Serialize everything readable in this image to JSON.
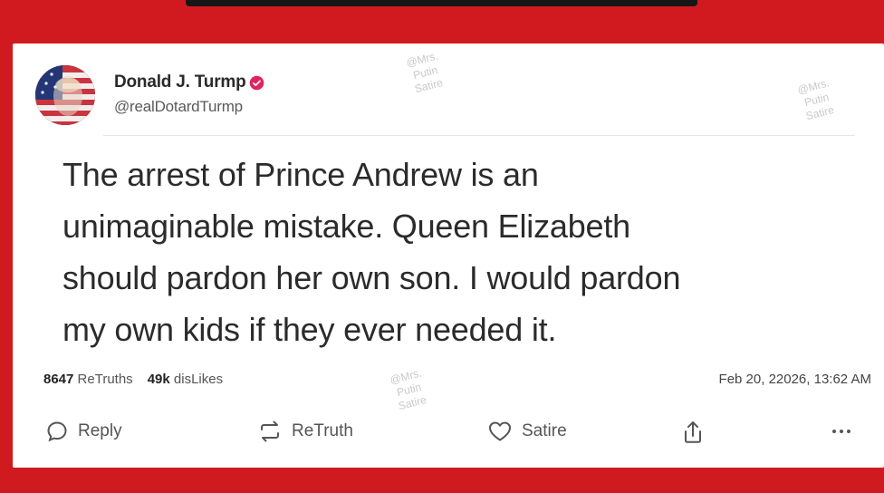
{
  "post": {
    "author": {
      "display_name": "Donald J. Turmp",
      "handle": "@realDotardTurmp"
    },
    "text_lines": [
      "The arrest of Prince Andrew is an",
      "unimaginable mistake. Queen Elizabeth",
      "should pardon her own son. I would pardon",
      "my own kids if they ever needed it."
    ],
    "stats": {
      "retruths_count": "8647",
      "retruths_label": "ReTruths",
      "dislikes_count": "49k",
      "dislikes_label": "disLikes"
    },
    "timestamp": "Feb 20, 22026, 13:62 AM"
  },
  "actions": {
    "reply_label": "Reply",
    "retruth_label": "ReTruth",
    "satire_label": "Satire"
  },
  "watermarks": [
    {
      "lines": [
        "@Mrs.",
        "Putin",
        "Satire"
      ]
    },
    {
      "lines": [
        "@Mrs.",
        "Putin",
        "Satire"
      ]
    },
    {
      "lines": [
        "@Mrs.",
        "Putin",
        "Satire"
      ]
    }
  ],
  "colors": {
    "background": "#d11a1f",
    "card": "#ffffff",
    "verified_badge": "#e0245e",
    "text": "#2b2b2b"
  },
  "icons": [
    "verified-badge-icon",
    "reply-icon",
    "retruth-icon",
    "heart-icon",
    "share-icon",
    "more-icon"
  ]
}
